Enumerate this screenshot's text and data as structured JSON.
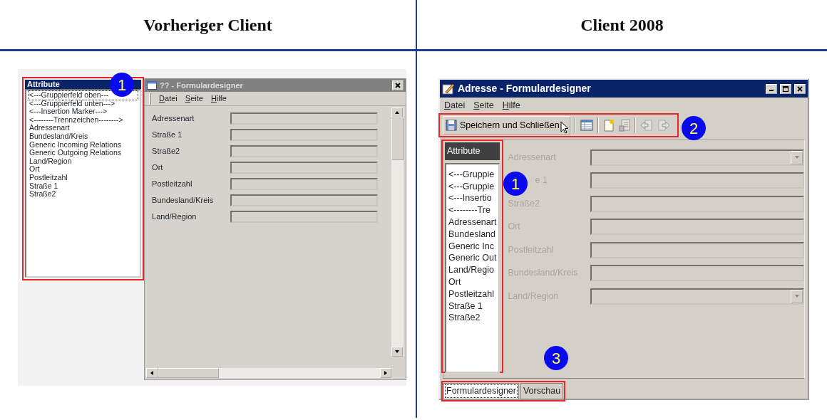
{
  "header": {
    "left": "Vorheriger Client",
    "right": "Client 2008"
  },
  "old_client": {
    "badge": "1",
    "attributes": {
      "title": "Attribute",
      "items": [
        {
          "label": "<---Gruppierfeld oben---",
          "selected": true
        },
        {
          "label": "<---Gruppierfeld unten--->",
          "selected": false
        },
        {
          "label": "<---Insertion Marker--->",
          "selected": false
        },
        {
          "label": "<--------Trennzeichen-------->",
          "selected": false
        },
        {
          "label": "Adressenart",
          "selected": false
        },
        {
          "label": "Bundesland/Kreis",
          "selected": false
        },
        {
          "label": "Generic Incoming Relations",
          "selected": false
        },
        {
          "label": "Generic Outgoing Relations",
          "selected": false
        },
        {
          "label": "Land/Region",
          "selected": false
        },
        {
          "label": "Ort",
          "selected": false
        },
        {
          "label": "Postleitzahl",
          "selected": false
        },
        {
          "label": "Straße 1",
          "selected": false
        },
        {
          "label": "Straße2",
          "selected": false
        }
      ]
    },
    "window": {
      "title": "?? - Formulardesigner",
      "active": false,
      "menu": [
        "Datei",
        "Seite",
        "Hilfe"
      ],
      "fields": [
        {
          "label": "Adressenart",
          "kind": "text",
          "disabled": false
        },
        {
          "label": "Straße 1",
          "kind": "text",
          "disabled": false
        },
        {
          "label": "Straße2",
          "kind": "text",
          "disabled": false
        },
        {
          "label": "Ort",
          "kind": "text",
          "disabled": false
        },
        {
          "label": "Postleitzahl",
          "kind": "text",
          "disabled": false
        },
        {
          "label": "Bundesland/Kreis",
          "kind": "text",
          "disabled": false
        },
        {
          "label": "Land/Region",
          "kind": "text",
          "disabled": false
        }
      ]
    }
  },
  "new_client": {
    "badges": [
      "2",
      "1",
      "3"
    ],
    "window": {
      "title": "Adresse - Formulardesigner",
      "active": true,
      "menu": [
        "Datei",
        "Seite",
        "Hilfe"
      ],
      "save_button": "Speichern und Schließen",
      "attributes": {
        "title": "Attribute",
        "items": [
          {
            "label": "<---Gruppie",
            "selected": false
          },
          {
            "label": "<---Gruppie",
            "selected": false
          },
          {
            "label": "<---Insertio",
            "selected": false
          },
          {
            "label": "<--------Tre",
            "selected": false
          },
          {
            "label": "Adressenart",
            "selected": false
          },
          {
            "label": "Bundesland",
            "selected": false
          },
          {
            "label": "Generic Inc",
            "selected": false
          },
          {
            "label": "Generic Out",
            "selected": false
          },
          {
            "label": "Land/Regio",
            "selected": false
          },
          {
            "label": "Ort",
            "selected": false
          },
          {
            "label": "Postleitzahl",
            "selected": false
          },
          {
            "label": "Straße 1",
            "selected": false
          },
          {
            "label": "Straße2",
            "selected": false
          }
        ]
      },
      "fields": [
        {
          "label": "Adressenart",
          "kind": "dropdown",
          "disabled": true
        },
        {
          "label": "e 1",
          "kind": "text",
          "disabled": true
        },
        {
          "label": "Straße2",
          "kind": "text",
          "disabled": true
        },
        {
          "label": "Ort",
          "kind": "text",
          "disabled": true
        },
        {
          "label": "Postleitzahl",
          "kind": "text",
          "disabled": true
        },
        {
          "label": "Bundesland/Kreis",
          "kind": "text",
          "disabled": true
        },
        {
          "label": "Land/Region",
          "kind": "dropdown",
          "disabled": true
        }
      ],
      "tabs": [
        {
          "label": "Formulardesigner",
          "selected": true
        },
        {
          "label": "Vorschau",
          "selected": false
        }
      ]
    }
  }
}
